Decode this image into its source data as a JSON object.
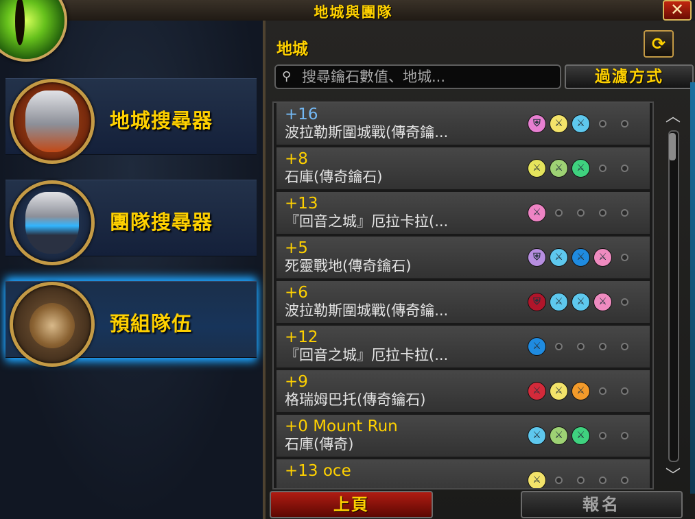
{
  "window": {
    "title": "地城與團隊",
    "close_label": "✕"
  },
  "sidebar": {
    "items": [
      {
        "label": "地城搜尋器",
        "emblem": "helmet-orange-emblem",
        "selected": false
      },
      {
        "label": "團隊搜尋器",
        "emblem": "helmet-blue-emblem",
        "selected": false
      },
      {
        "label": "預組隊伍",
        "emblem": "premade-group-emblem",
        "selected": true
      }
    ]
  },
  "main": {
    "section_title": "地城",
    "refresh_icon": "refresh-icon",
    "search": {
      "placeholder": "搜尋鑰石數值、地城...",
      "value": ""
    },
    "filter_label": "過濾方式",
    "groups": [
      {
        "level": "+16",
        "highlight": "blue",
        "name": "波拉勒斯圍城戰(傳奇鑰...",
        "roles": [
          "tank",
          "healer",
          "dps"
        ],
        "filled": 3
      },
      {
        "level": "+8",
        "highlight": "gold",
        "name": "石庫(傳奇鑰石)",
        "roles": [
          "healer",
          "dps",
          "dps"
        ],
        "filled": 3
      },
      {
        "level": "+13",
        "highlight": "gold",
        "name": "『回音之城』厄拉卡拉(...",
        "roles": [
          "dps"
        ],
        "filled": 1
      },
      {
        "level": "+5",
        "highlight": "gold",
        "name": "死靈戰地(傳奇鑰石)",
        "roles": [
          "tank",
          "dps",
          "dps",
          "dps"
        ],
        "filled": 4
      },
      {
        "level": "+6",
        "highlight": "gold",
        "name": "波拉勒斯圍城戰(傳奇鑰...",
        "roles": [
          "tank",
          "dps",
          "dps",
          "dps"
        ],
        "filled": 4
      },
      {
        "level": "+12",
        "highlight": "gold",
        "name": "『回音之城』厄拉卡拉(...",
        "roles": [
          "dps"
        ],
        "filled": 1
      },
      {
        "level": "+9",
        "highlight": "gold",
        "name": "格瑞姆巴托(傳奇鑰石)",
        "roles": [
          "dps",
          "dps",
          "dps"
        ],
        "filled": 3
      },
      {
        "level": "+0 Mount Run",
        "highlight": "gold",
        "name": "石庫(傳奇)",
        "roles": [
          "dps",
          "dps",
          "dps"
        ],
        "filled": 3
      },
      {
        "level": "+13 oce",
        "highlight": "gold",
        "name": "",
        "roles": [
          "dps"
        ],
        "filled": 1
      }
    ],
    "slot_colors": [
      [
        "#e77fd1",
        "#f3e36a",
        "#5ec8ee",
        "",
        ""
      ],
      [
        "#e5e45c",
        "#9ed274",
        "#3fd27f",
        "",
        ""
      ],
      [
        "#ee84c4",
        "",
        "",
        "",
        ""
      ],
      [
        "#b78ee0",
        "#5ec8ee",
        "#1f8be0",
        "#ef8bc0",
        ""
      ],
      [
        "#b0152a",
        "#5ec8ee",
        "#5ec8ee",
        "#ef8bc0",
        ""
      ],
      [
        "#1f8be0",
        "",
        "",
        "",
        ""
      ],
      [
        "#d32a3a",
        "#f3e36a",
        "#f39a2a",
        "",
        ""
      ],
      [
        "#5ec8ee",
        "#9ed274",
        "#3fd27f",
        "",
        ""
      ],
      [
        "#f3e36a",
        "",
        "",
        "",
        ""
      ]
    ],
    "buttons": {
      "prev": "上頁",
      "signup": "報名"
    }
  }
}
